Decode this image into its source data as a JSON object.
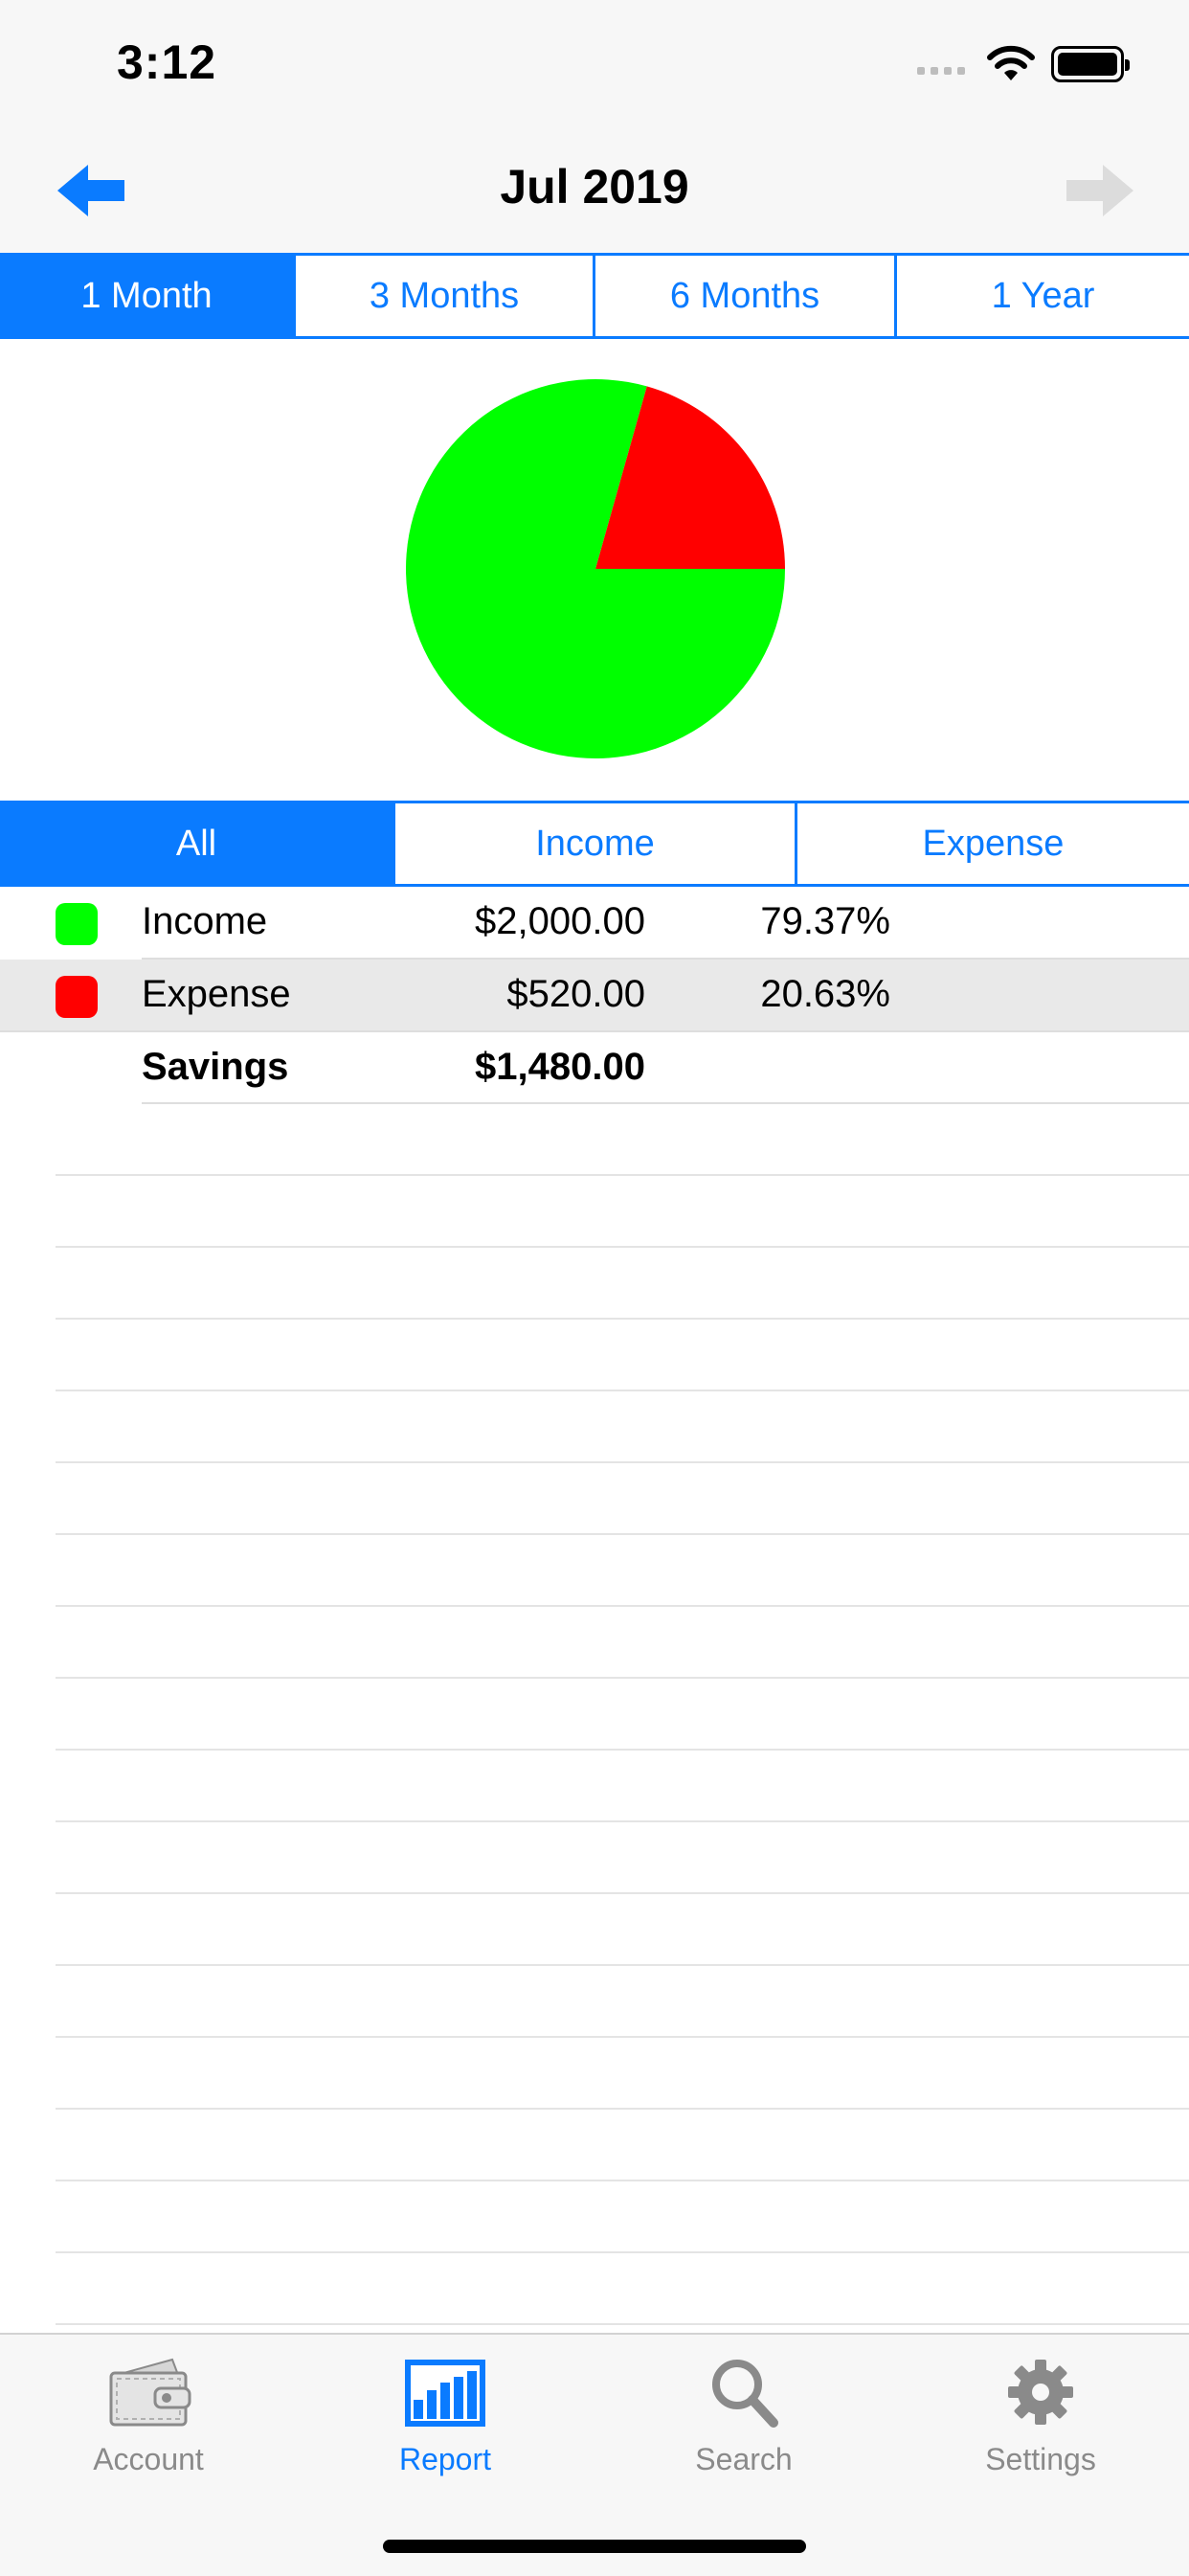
{
  "status_bar": {
    "time": "3:12"
  },
  "nav": {
    "title": "Jul 2019",
    "back_icon": "arrow-left-icon",
    "forward_icon": "arrow-right-icon"
  },
  "period_tabs": {
    "items": [
      "1 Month",
      "3 Months",
      "6 Months",
      "1 Year"
    ],
    "selected": "1 Month"
  },
  "filter_tabs": {
    "items": [
      "All",
      "Income",
      "Expense"
    ],
    "selected": "All"
  },
  "summary": {
    "rows": [
      {
        "label": "Income",
        "amount": "$2,000.00",
        "percent": "79.37%",
        "color": "#00ff00"
      },
      {
        "label": "Expense",
        "amount": "$520.00",
        "percent": "20.63%",
        "color": "#ff0000"
      }
    ],
    "total": {
      "label": "Savings",
      "amount": "$1,480.00"
    }
  },
  "chart_data": {
    "type": "pie",
    "slices": [
      {
        "label": "Income",
        "value": 79.37,
        "color": "#00ff00"
      },
      {
        "label": "Expense",
        "value": 20.63,
        "color": "#ff0000"
      }
    ]
  },
  "tab_bar": {
    "items": [
      {
        "label": "Account",
        "icon": "wallet-icon"
      },
      {
        "label": "Report",
        "icon": "bar-chart-icon"
      },
      {
        "label": "Search",
        "icon": "search-icon"
      },
      {
        "label": "Settings",
        "icon": "gear-icon"
      }
    ],
    "selected": "Report"
  },
  "colors": {
    "accent": "#0a7bff",
    "income": "#00ff00",
    "expense": "#ff0000"
  }
}
